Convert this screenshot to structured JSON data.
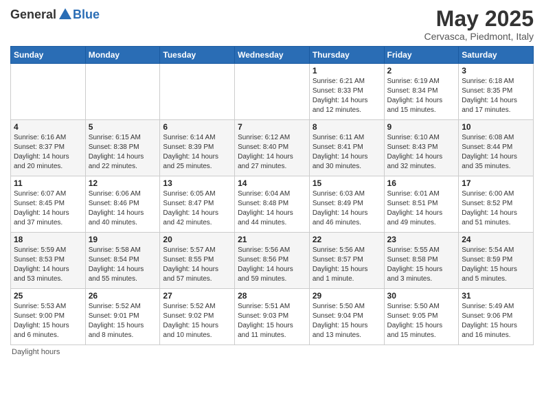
{
  "logo": {
    "general": "General",
    "blue": "Blue"
  },
  "header": {
    "month": "May 2025",
    "location": "Cervasca, Piedmont, Italy"
  },
  "weekdays": [
    "Sunday",
    "Monday",
    "Tuesday",
    "Wednesday",
    "Thursday",
    "Friday",
    "Saturday"
  ],
  "weeks": [
    [
      {
        "day": "",
        "sunrise": "",
        "sunset": "",
        "daylight": ""
      },
      {
        "day": "",
        "sunrise": "",
        "sunset": "",
        "daylight": ""
      },
      {
        "day": "",
        "sunrise": "",
        "sunset": "",
        "daylight": ""
      },
      {
        "day": "",
        "sunrise": "",
        "sunset": "",
        "daylight": ""
      },
      {
        "day": "1",
        "sunrise": "Sunrise: 6:21 AM",
        "sunset": "Sunset: 8:33 PM",
        "daylight": "Daylight: 14 hours and 12 minutes."
      },
      {
        "day": "2",
        "sunrise": "Sunrise: 6:19 AM",
        "sunset": "Sunset: 8:34 PM",
        "daylight": "Daylight: 14 hours and 15 minutes."
      },
      {
        "day": "3",
        "sunrise": "Sunrise: 6:18 AM",
        "sunset": "Sunset: 8:35 PM",
        "daylight": "Daylight: 14 hours and 17 minutes."
      }
    ],
    [
      {
        "day": "4",
        "sunrise": "Sunrise: 6:16 AM",
        "sunset": "Sunset: 8:37 PM",
        "daylight": "Daylight: 14 hours and 20 minutes."
      },
      {
        "day": "5",
        "sunrise": "Sunrise: 6:15 AM",
        "sunset": "Sunset: 8:38 PM",
        "daylight": "Daylight: 14 hours and 22 minutes."
      },
      {
        "day": "6",
        "sunrise": "Sunrise: 6:14 AM",
        "sunset": "Sunset: 8:39 PM",
        "daylight": "Daylight: 14 hours and 25 minutes."
      },
      {
        "day": "7",
        "sunrise": "Sunrise: 6:12 AM",
        "sunset": "Sunset: 8:40 PM",
        "daylight": "Daylight: 14 hours and 27 minutes."
      },
      {
        "day": "8",
        "sunrise": "Sunrise: 6:11 AM",
        "sunset": "Sunset: 8:41 PM",
        "daylight": "Daylight: 14 hours and 30 minutes."
      },
      {
        "day": "9",
        "sunrise": "Sunrise: 6:10 AM",
        "sunset": "Sunset: 8:43 PM",
        "daylight": "Daylight: 14 hours and 32 minutes."
      },
      {
        "day": "10",
        "sunrise": "Sunrise: 6:08 AM",
        "sunset": "Sunset: 8:44 PM",
        "daylight": "Daylight: 14 hours and 35 minutes."
      }
    ],
    [
      {
        "day": "11",
        "sunrise": "Sunrise: 6:07 AM",
        "sunset": "Sunset: 8:45 PM",
        "daylight": "Daylight: 14 hours and 37 minutes."
      },
      {
        "day": "12",
        "sunrise": "Sunrise: 6:06 AM",
        "sunset": "Sunset: 8:46 PM",
        "daylight": "Daylight: 14 hours and 40 minutes."
      },
      {
        "day": "13",
        "sunrise": "Sunrise: 6:05 AM",
        "sunset": "Sunset: 8:47 PM",
        "daylight": "Daylight: 14 hours and 42 minutes."
      },
      {
        "day": "14",
        "sunrise": "Sunrise: 6:04 AM",
        "sunset": "Sunset: 8:48 PM",
        "daylight": "Daylight: 14 hours and 44 minutes."
      },
      {
        "day": "15",
        "sunrise": "Sunrise: 6:03 AM",
        "sunset": "Sunset: 8:49 PM",
        "daylight": "Daylight: 14 hours and 46 minutes."
      },
      {
        "day": "16",
        "sunrise": "Sunrise: 6:01 AM",
        "sunset": "Sunset: 8:51 PM",
        "daylight": "Daylight: 14 hours and 49 minutes."
      },
      {
        "day": "17",
        "sunrise": "Sunrise: 6:00 AM",
        "sunset": "Sunset: 8:52 PM",
        "daylight": "Daylight: 14 hours and 51 minutes."
      }
    ],
    [
      {
        "day": "18",
        "sunrise": "Sunrise: 5:59 AM",
        "sunset": "Sunset: 8:53 PM",
        "daylight": "Daylight: 14 hours and 53 minutes."
      },
      {
        "day": "19",
        "sunrise": "Sunrise: 5:58 AM",
        "sunset": "Sunset: 8:54 PM",
        "daylight": "Daylight: 14 hours and 55 minutes."
      },
      {
        "day": "20",
        "sunrise": "Sunrise: 5:57 AM",
        "sunset": "Sunset: 8:55 PM",
        "daylight": "Daylight: 14 hours and 57 minutes."
      },
      {
        "day": "21",
        "sunrise": "Sunrise: 5:56 AM",
        "sunset": "Sunset: 8:56 PM",
        "daylight": "Daylight: 14 hours and 59 minutes."
      },
      {
        "day": "22",
        "sunrise": "Sunrise: 5:56 AM",
        "sunset": "Sunset: 8:57 PM",
        "daylight": "Daylight: 15 hours and 1 minute."
      },
      {
        "day": "23",
        "sunrise": "Sunrise: 5:55 AM",
        "sunset": "Sunset: 8:58 PM",
        "daylight": "Daylight: 15 hours and 3 minutes."
      },
      {
        "day": "24",
        "sunrise": "Sunrise: 5:54 AM",
        "sunset": "Sunset: 8:59 PM",
        "daylight": "Daylight: 15 hours and 5 minutes."
      }
    ],
    [
      {
        "day": "25",
        "sunrise": "Sunrise: 5:53 AM",
        "sunset": "Sunset: 9:00 PM",
        "daylight": "Daylight: 15 hours and 6 minutes."
      },
      {
        "day": "26",
        "sunrise": "Sunrise: 5:52 AM",
        "sunset": "Sunset: 9:01 PM",
        "daylight": "Daylight: 15 hours and 8 minutes."
      },
      {
        "day": "27",
        "sunrise": "Sunrise: 5:52 AM",
        "sunset": "Sunset: 9:02 PM",
        "daylight": "Daylight: 15 hours and 10 minutes."
      },
      {
        "day": "28",
        "sunrise": "Sunrise: 5:51 AM",
        "sunset": "Sunset: 9:03 PM",
        "daylight": "Daylight: 15 hours and 11 minutes."
      },
      {
        "day": "29",
        "sunrise": "Sunrise: 5:50 AM",
        "sunset": "Sunset: 9:04 PM",
        "daylight": "Daylight: 15 hours and 13 minutes."
      },
      {
        "day": "30",
        "sunrise": "Sunrise: 5:50 AM",
        "sunset": "Sunset: 9:05 PM",
        "daylight": "Daylight: 15 hours and 15 minutes."
      },
      {
        "day": "31",
        "sunrise": "Sunrise: 5:49 AM",
        "sunset": "Sunset: 9:06 PM",
        "daylight": "Daylight: 15 hours and 16 minutes."
      }
    ]
  ],
  "footer": {
    "note": "Daylight hours"
  }
}
